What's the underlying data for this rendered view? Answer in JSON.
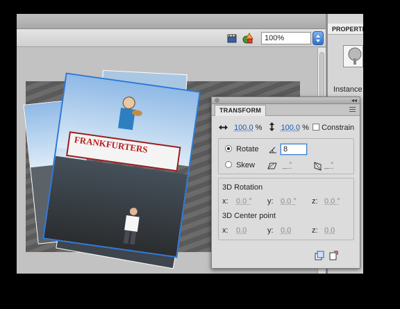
{
  "toolbar": {
    "zoom_value": "100%",
    "edit_scene_icon": "clapper-board-icon",
    "edit_symbol_icon": "shapes-icon"
  },
  "properties_panel": {
    "tab_label": "PROPERTIES",
    "instance_label": "Instance"
  },
  "stage": {
    "photo_sign_text": "FRANKFURTERS"
  },
  "transform_panel": {
    "tab_label": "TRANSFORM",
    "scale_width": "100.0",
    "scale_height": "100.0",
    "percent": "%",
    "constrain_label": "Constrain",
    "rotate_label": "Rotate",
    "rotate_value": "8",
    "skew_label": "Skew",
    "skew_h_value": "_ °",
    "skew_v_value": "_ °",
    "rotation_3d_title": "3D Rotation",
    "rotation_3d": {
      "x_label": "x:",
      "x": "0.0 °",
      "y_label": "y:",
      "y": "0.0 °",
      "z_label": "z:",
      "z": "0.0 °"
    },
    "center_3d_title": "3D Center point",
    "center_3d": {
      "x_label": "x:",
      "x": "0.0",
      "y_label": "y:",
      "y": "0.0",
      "z_label": "z:",
      "z": "0.0"
    },
    "icons": [
      "duplicate-and-transform-icon",
      "reset-transform-icon"
    ]
  },
  "colors": {
    "accent": "#1a55b8",
    "panel_bg": "#dcdcdc",
    "toolbar_bg": "#cfcfcf"
  }
}
